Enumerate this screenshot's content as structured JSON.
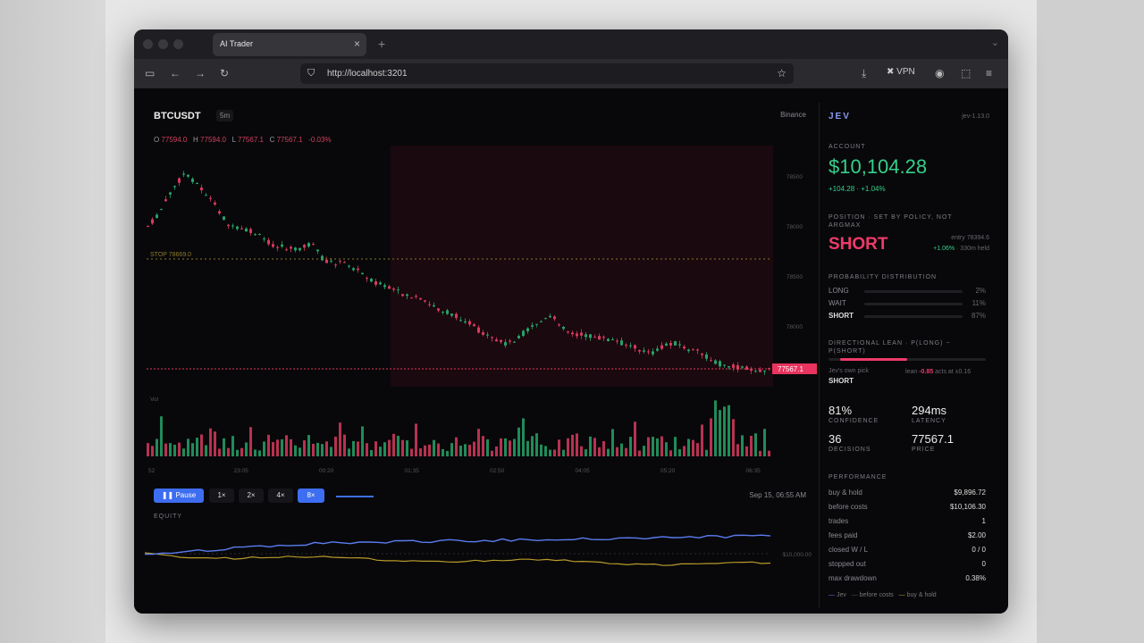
{
  "browser": {
    "tab_title": "AI Trader",
    "url": "http://localhost:3201",
    "vpn_label": "VPN"
  },
  "chart": {
    "symbol": "BTCUSDT",
    "timeframe": "5m",
    "exchange": "Binance",
    "ohlc": {
      "o": "77594.0",
      "h": "77594.0",
      "l": "77567.1",
      "c": "77567.1",
      "chg": "-0.03%"
    },
    "stop_label": "STOP 78669.0",
    "last_price_tag": "77567.1",
    "vol_label": "Vol",
    "price_ticks": [
      "78500",
      "78000",
      "78500",
      "78000"
    ],
    "time_ticks": [
      "52",
      "23:05",
      "00:20",
      "01:35",
      "02:50",
      "04:05",
      "05:20",
      "06:35"
    ],
    "colors": {
      "up": "#26a269",
      "down": "#d63a5e",
      "stop": "#8a7a2a",
      "last": "#e8345f"
    }
  },
  "controls": {
    "pause_label": "❚❚ Pause",
    "speeds": [
      "1×",
      "2×",
      "4×",
      "8×"
    ],
    "active_speed": "8×",
    "timestamp": "Sep 15, 06:55 AM"
  },
  "equity": {
    "label": "EQUITY",
    "ref_value": "$10,000.00"
  },
  "sidebar": {
    "brand": "JEV",
    "version": "jev-1.13.0",
    "account_label": "ACCOUNT",
    "balance": "$10,104.28",
    "balance_change": "+104.28 · +1.04%",
    "position_label": "POSITION · SET BY POLICY, NOT ARGMAX",
    "position": "SHORT",
    "entry": "entry 78394.6",
    "position_pnl": "+1.06%",
    "position_held": "· 330m held",
    "prob_label": "PROBABILITY DISTRIBUTION",
    "probs": [
      {
        "name": "LONG",
        "value": "2%"
      },
      {
        "name": "WAIT",
        "value": "11%"
      },
      {
        "name": "SHORT",
        "value": "87%"
      }
    ],
    "lean_label": "DIRECTIONAL LEAN · P(LONG) − P(SHORT)",
    "pick_label": "Jev's own pick",
    "pick_value": "SHORT",
    "lean_text": "lean",
    "lean_value": "-0.85",
    "lean_acts": "acts at ±0.16",
    "stats": [
      {
        "value": "81%",
        "label": "CONFIDENCE"
      },
      {
        "value": "294ms",
        "label": "LATENCY"
      },
      {
        "value": "36",
        "label": "DECISIONS"
      },
      {
        "value": "77567.1",
        "label": "PRICE"
      }
    ],
    "perf_label": "PERFORMANCE",
    "perf": [
      {
        "k": "buy & hold",
        "v": "$9,896.72"
      },
      {
        "k": "before costs",
        "v": "$10,106.30"
      },
      {
        "k": "trades",
        "v": "1"
      },
      {
        "k": "fees paid",
        "v": "$2.00"
      },
      {
        "k": "closed W / L",
        "v": "0 / 0"
      },
      {
        "k": "stopped out",
        "v": "0"
      },
      {
        "k": "max drawdown",
        "v": "0.38%"
      }
    ],
    "legend": [
      "Jev",
      "before costs",
      "buy & hold"
    ]
  }
}
